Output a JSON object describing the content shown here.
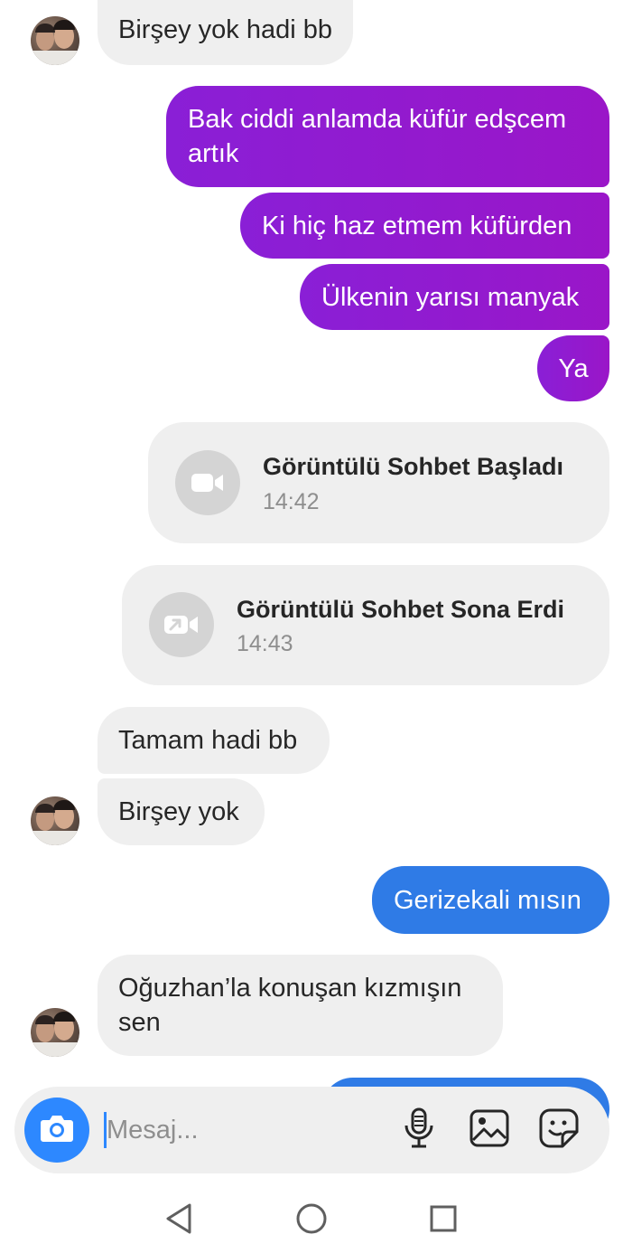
{
  "messages": {
    "m1": "Birşey yok hadi bb",
    "m2": "Bak ciddi anlamda küfür edşcem artık",
    "m3": "Ki hiç haz etmem küfürden",
    "m4": "Ülkenin yarısı manyak",
    "m5": "Ya",
    "m6": "Tamam hadi bb",
    "m7": "Birşey yok",
    "m8": "Gerizekali mısın",
    "m9": "Oğuzhan’la konuşan kızmışın sen"
  },
  "calls": {
    "started": {
      "title": "Görüntülü Sohbet Başladı",
      "time": "14:42",
      "icon": "video-camera-icon"
    },
    "ended": {
      "title": "Görüntülü Sohbet Sona Erdi",
      "time": "14:43",
      "icon": "video-call-ended-icon"
    }
  },
  "composer": {
    "placeholder": "Mesaj...",
    "icons": [
      "camera-icon",
      "microphone-icon",
      "gallery-icon",
      "sticker-icon"
    ]
  },
  "navbar": {
    "icons": [
      "back-triangle-icon",
      "home-circle-icon",
      "recents-square-icon"
    ]
  },
  "colors": {
    "outgoing_purple": "#8a1fd6",
    "outgoing_blue": "#2f7be6",
    "incoming_gray": "#efefef",
    "accent_blue": "#2d88ff"
  }
}
